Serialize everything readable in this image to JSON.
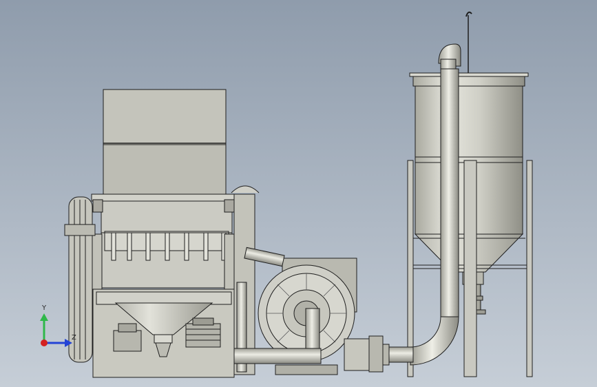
{
  "view": {
    "background_top": "#8f9cac",
    "background_bottom": "#c6ced7",
    "body_color": "#c8c8bf",
    "edge_color": "#1e1e1e"
  },
  "triad": {
    "y_label": "Y",
    "z_label": "Z",
    "y_color": "#2fb84a",
    "z_color": "#2343d6",
    "x_color": "#d32020"
  }
}
